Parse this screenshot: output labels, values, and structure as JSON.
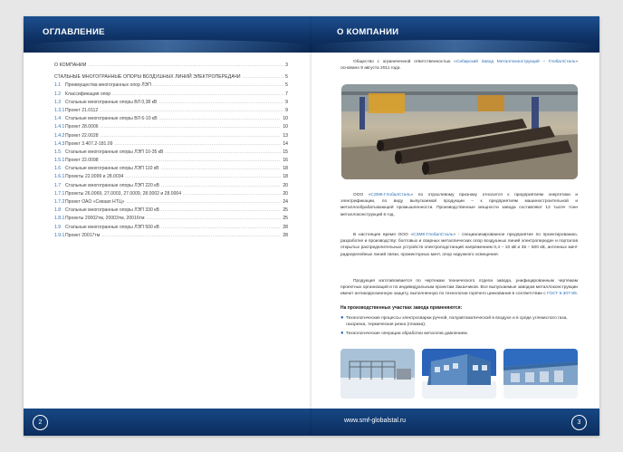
{
  "left_page": {
    "header_title": "ОГЛАВЛЕНИЕ",
    "page_number": "2",
    "toc": [
      {
        "num": "",
        "title": "О КОМПАНИИ",
        "page": "3",
        "upper": true
      },
      {
        "num": "",
        "title": "СТАЛЬНЫЕ МНОГОГРАННЫЕ ОПОРЫ ВОЗДУШНЫХ ЛИНИЙ ЭЛЕКТРОПЕРЕДАЧИ",
        "page": "5",
        "upper": true
      },
      {
        "num": "1.1",
        "title": "Преимущества многогранных опор ЛЭП",
        "page": "5"
      },
      {
        "num": "1.2",
        "title": "Классификация опор",
        "page": "7"
      },
      {
        "num": "1.3",
        "title": "Стальные многогранные опоры ВЛ 0,38 кВ",
        "page": "9"
      },
      {
        "num": "1.3.1",
        "title": "Проект 21.0112",
        "page": "9"
      },
      {
        "num": "1.4",
        "title": "Стальные многогранные опоры ВЛ 6-10 кВ",
        "page": "10"
      },
      {
        "num": "1.4.1",
        "title": "Проект 28.0006",
        "page": "10"
      },
      {
        "num": "1.4.2",
        "title": "Проект 22.0028",
        "page": "13"
      },
      {
        "num": "1.4.3",
        "title": "Проект 3.407.2-181.09",
        "page": "14"
      },
      {
        "num": "1.5",
        "title": "Стальные многогранные опоры ЛЭП 10-35 кВ",
        "page": "15"
      },
      {
        "num": "1.5.1",
        "title": "Проект 22.0098",
        "page": "16"
      },
      {
        "num": "1.6",
        "title": "Стальные многогранные опоры ЛЭП 110 кВ",
        "page": "18"
      },
      {
        "num": "1.6.1",
        "title": "Проекты 22.0099 и 28.0034",
        "page": "18"
      },
      {
        "num": "1.7",
        "title": "Стальные многогранные опоры ЛЭП 220 кВ",
        "page": "20"
      },
      {
        "num": "1.7.1",
        "title": "Проекты 26.0069, 27.0003, 27.0009, 28.0002 и 28.0004",
        "page": "20"
      },
      {
        "num": "1.7.2",
        "title": "Проект ОАО «Севзап НТЦ»",
        "page": "24"
      },
      {
        "num": "1.8",
        "title": "Стальные многогранные опоры ЛЭП 330 кВ",
        "page": "25"
      },
      {
        "num": "1.8.1",
        "title": "Проекты 20002тм, 20003тм, 20016тм",
        "page": "25"
      },
      {
        "num": "1.9",
        "title": "Стальные многогранные опоры ЛЭП 500 кВ",
        "page": "28"
      },
      {
        "num": "1.9.1",
        "title": "Проект 20017тм",
        "page": "28"
      }
    ]
  },
  "right_page": {
    "header_title": "О КОМПАНИИ",
    "page_number": "3",
    "footer_url": "www.smf-globalstal.ru",
    "intro": {
      "before": "Общество с ограниченной ответственностью «",
      "link": "Сибирский Завод Металлоконструкций – ГлобалСталь",
      "after": "» основано 9 августа 2011 года."
    },
    "para1": {
      "before": "ООО «",
      "link": "СЗМК-ГлобалСталь",
      "after": "» по отраслевому признаку относится к предприятиям энергетики и электрификации, по виду выпускаемой продукции – к предприятиям машиностроительной и металлообрабатывающей промышленности. Производственные мощности завода составляют 12 тысяч тонн металлоконструкций в год."
    },
    "para2": {
      "before": "В настоящее время ООО «",
      "link": "СЗМК-ГлобалСталь",
      "after": "» - специализированное предприятие по проектированию, разработке и производству: болтовых и сварных металлических опор воздушных линий электропередач и порталов открытых распределительных устройств электроподстанций напряжением 0,4 – 10 кВ и 35 – 500 кВ, антенных мачт радиорелейных линий связи, прожекторных мачт, опор наружного освещения."
    },
    "para3": {
      "before": "Продукция изготавливается по чертежам технического отдела завода, унифицированным чертежам проектных организаций и по индивидуальным проектам Заказчиков. Все выпускаемые заводом металлоконструкции имеют антикоррозионную защиту, выполненную по технологии горячего цинкования в соответствии с ",
      "link": "ГОСТ 9.307-89",
      "after": "."
    },
    "bold_heading": "На производственных участках завода применяются:",
    "bullets": [
      "Технологические процессы электросварки ручной, полуавтоматической в воздухе и в среде углекислого газа, газорезка, термическая резка (плазма);",
      "Технологические операции обработки металлов давлением."
    ]
  },
  "colors": {
    "header_blue": "#0e3264",
    "link_blue": "#2b6fb5"
  }
}
